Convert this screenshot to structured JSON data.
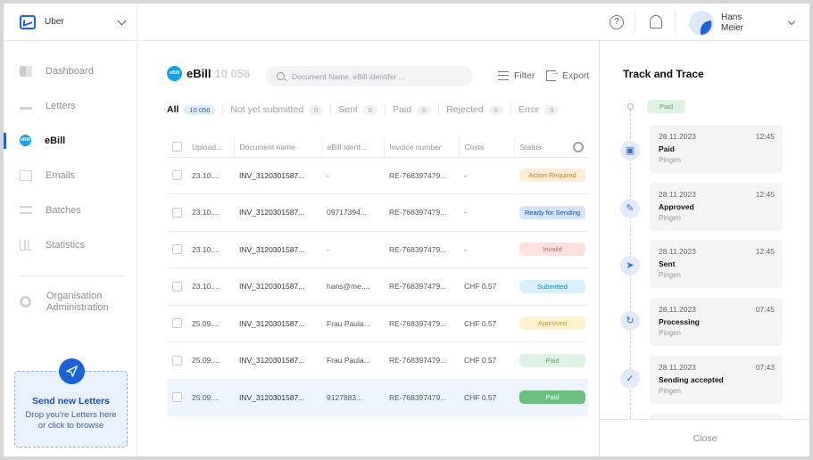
{
  "org": {
    "name": "Uber"
  },
  "nav": {
    "items": [
      {
        "label": "Dashboard"
      },
      {
        "label": "Letters"
      },
      {
        "label": "eBill"
      },
      {
        "label": "Emails"
      },
      {
        "label": "Batches"
      },
      {
        "label": "Statistics"
      }
    ],
    "admin_line1": "Organisation",
    "admin_line2": "Administration"
  },
  "upload": {
    "title": "Send new Letters",
    "subtitle": "Drop you're Letters here or click to browse"
  },
  "header": {
    "help_glyph": "?",
    "user_first": "Hans",
    "user_last": "Meier"
  },
  "main": {
    "title": "eBill",
    "title_count": "10 056",
    "search_placeholder": "Document Name, eBill identifer ...",
    "filter_label": "Filter",
    "export_label": "Export",
    "tabs": [
      {
        "label": "All",
        "count": "10 056"
      },
      {
        "label": "Not yet submitted",
        "count": "0"
      },
      {
        "label": "Sent",
        "count": "0"
      },
      {
        "label": "Paid",
        "count": "0"
      },
      {
        "label": "Rejected",
        "count": "0"
      },
      {
        "label": "Error",
        "count": "0"
      }
    ],
    "columns": [
      "Upload...",
      "Document name",
      "eBill Ident...",
      "Invoice number",
      "Costs",
      "Status"
    ],
    "rows": [
      {
        "date": "23.10....",
        "doc": "INV_3120301587...",
        "ident": "-",
        "invoice": "RE-768397479...",
        "cost": "-",
        "status": "Action Required"
      },
      {
        "date": "23.10....",
        "doc": "INV_3120301587...",
        "ident": "09717394...",
        "invoice": "RE-768397479...",
        "cost": "-",
        "status": "Ready for Sending"
      },
      {
        "date": "23.10....",
        "doc": "INV_3120301587...",
        "ident": "-",
        "invoice": "RE-768397479...",
        "cost": "-",
        "status": "Invalid"
      },
      {
        "date": "23.10....",
        "doc": "INV_3120301587...",
        "ident": "hans@me....",
        "invoice": "RE-768397479...",
        "cost": "CHF 0.57",
        "status": "Submitted"
      },
      {
        "date": "25.09....",
        "doc": "INV_3120301587...",
        "ident": "Frau Paula...",
        "invoice": "RE-768397479...",
        "cost": "CHF 0.57",
        "status": "Approved"
      },
      {
        "date": "25.09....",
        "doc": "INV_3120301587...",
        "ident": "Frau Paula...",
        "invoice": "RE-768397479...",
        "cost": "CHF 0.57",
        "status": "Paid"
      },
      {
        "date": "25.09....",
        "doc": "INV_3120301587...",
        "ident": "9127883...",
        "invoice": "RE-768397479...",
        "cost": "CHF 0.57",
        "status": "Paid"
      }
    ]
  },
  "panel": {
    "title": "Track and Trace",
    "current_status": "Paid",
    "events": [
      {
        "date": "28.11.2023",
        "time": "12:45",
        "title": "Paid",
        "sub": "Pingen",
        "icon": "wallet-icon"
      },
      {
        "date": "28.11.2023",
        "time": "12:45",
        "title": "Approved",
        "sub": "Pingen",
        "icon": "signature-icon"
      },
      {
        "date": "28.11.2023",
        "time": "12:45",
        "title": "Sent",
        "sub": "Pingen",
        "icon": "send-icon"
      },
      {
        "date": "28.11.2023",
        "time": "07:45",
        "title": "Processing",
        "sub": "Pingen",
        "icon": "refresh-icon"
      },
      {
        "date": "28.11.2023",
        "time": "07:43",
        "title": "Sending accepted",
        "sub": "Pingen",
        "icon": "check-icon"
      }
    ],
    "close_label": "Close"
  },
  "colors": {
    "accent": "#1e63d6",
    "ebill": "#17a1e3",
    "paid": "#6cbf7f"
  }
}
